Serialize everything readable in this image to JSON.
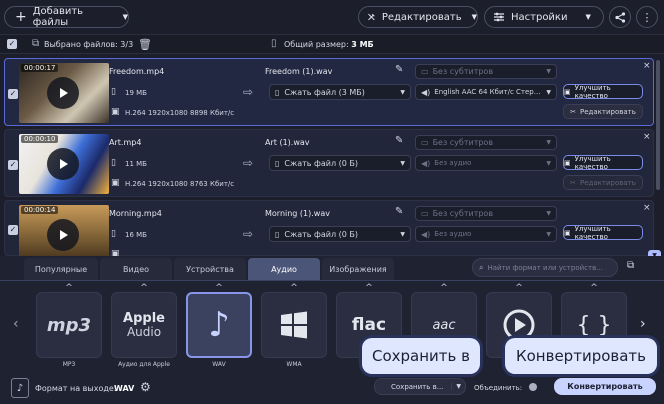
{
  "toolbar": {
    "add_files": "Добавить файлы",
    "edit": "Редактировать",
    "settings": "Настройки"
  },
  "selection": {
    "selected": "Выбрано файлов: 3/3",
    "total_label": "Общий размер:",
    "total_value": "3 МБ"
  },
  "files": [
    {
      "duration": "00:00:17",
      "name": "Freedom.mp4",
      "size": "19 МБ",
      "info": "H.264 1920x1080 8898 Кбит/с",
      "out_name": "Freedom (1).wav",
      "compress": "Сжать файл (3 МБ)",
      "subs": "Без субтитров",
      "audio": "English AAC 64 Кбит/с Стер...",
      "audio_on": true
    },
    {
      "duration": "00:00:10",
      "name": "Art.mp4",
      "size": "11 МБ",
      "info": "H.264 1920x1080 8763 Кбит/с",
      "out_name": "Art (1).wav",
      "compress": "Сжать файл (0 Б)",
      "subs": "Без субтитров",
      "audio": "Без аудио",
      "audio_on": false
    },
    {
      "duration": "00:00:14",
      "name": "Morning.mp4",
      "size": "16 МБ",
      "info": "",
      "out_name": "Morning (1).wav",
      "compress": "Сжать файл (0 Б)",
      "subs": "Без субтитров",
      "audio": "Без аудио",
      "audio_on": false
    }
  ],
  "row_buttons": {
    "improve": "Улучшить качество",
    "edit": "Редактировать"
  },
  "tabs": [
    {
      "label": "Популярные"
    },
    {
      "label": "Видео"
    },
    {
      "label": "Устройства"
    },
    {
      "label": "Аудио",
      "active": true
    },
    {
      "label": "Изображения"
    }
  ],
  "search": {
    "placeholder": "Найти формат или устройств..."
  },
  "formats": [
    {
      "label": "MP3",
      "logo": "mp3"
    },
    {
      "label": "Аудио для Apple",
      "logo": "Apple",
      "logo2": "Audio"
    },
    {
      "label": "WAV",
      "logo": "music-note",
      "active": true
    },
    {
      "label": "WMA",
      "logo": "windows-logo"
    },
    {
      "label": "",
      "logo": "flac"
    },
    {
      "label": "",
      "logo": "aac"
    },
    {
      "label": "",
      "logo": "play-circle"
    },
    {
      "label": "",
      "logo": "{ }"
    }
  ],
  "bottom": {
    "output_label": "Формат на выходе:",
    "output_value": "WAV",
    "save_to": "Сохранить в...",
    "merge": "Объединить:",
    "convert": "Конвертировать"
  },
  "callouts": {
    "save": "Сохранить в",
    "convert": "Конвертировать"
  },
  "colors": {
    "accent": "#7b8ce8",
    "bg": "#1c1f2b",
    "convert_btn": "#c8d3ff"
  }
}
